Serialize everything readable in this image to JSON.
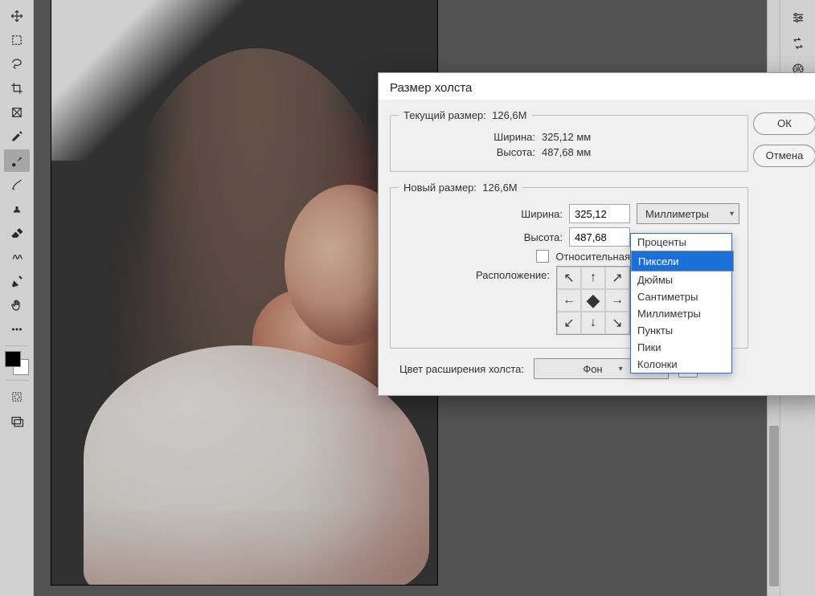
{
  "dialog": {
    "title": "Размер холста",
    "current": {
      "legend_prefix": "Текущий размер:",
      "size": "126,6M",
      "width_label": "Ширина:",
      "width_value": "325,12 мм",
      "height_label": "Высота:",
      "height_value": "487,68 мм"
    },
    "new": {
      "legend_prefix": "Новый размер:",
      "size": "126,6M",
      "width_label": "Ширина:",
      "width_value": "325,12",
      "height_label": "Высота:",
      "height_value": "487,68",
      "unit_selected": "Миллиметры",
      "relative_label": "Относительная",
      "anchor_label": "Расположение:"
    },
    "ext_color_label": "Цвет расширения холста:",
    "ext_color_value": "Фон",
    "ok": "ОК",
    "cancel": "Отмена"
  },
  "units_dropdown": {
    "options": [
      "Проценты",
      "Пиксели",
      "Дюймы",
      "Сантиметры",
      "Миллиметры",
      "Пункты",
      "Пики",
      "Колонки"
    ],
    "highlighted": "Пиксели"
  },
  "toolbar_icons": [
    "move-tool",
    "artboard-tool",
    "lasso-tool",
    "crop-tool",
    "placeholder-tool",
    "eyedropper-tool",
    "brush-tool",
    "mixer-brush-tool",
    "pattern-stamp-tool",
    "eraser-tool",
    "bucket-tool",
    "pen-tool",
    "hand-tool",
    "more-tool"
  ],
  "toolbar_selected_index": 6,
  "right_icons": [
    "options-icon",
    "unit-swap-icon",
    "settings-gear-icon"
  ]
}
